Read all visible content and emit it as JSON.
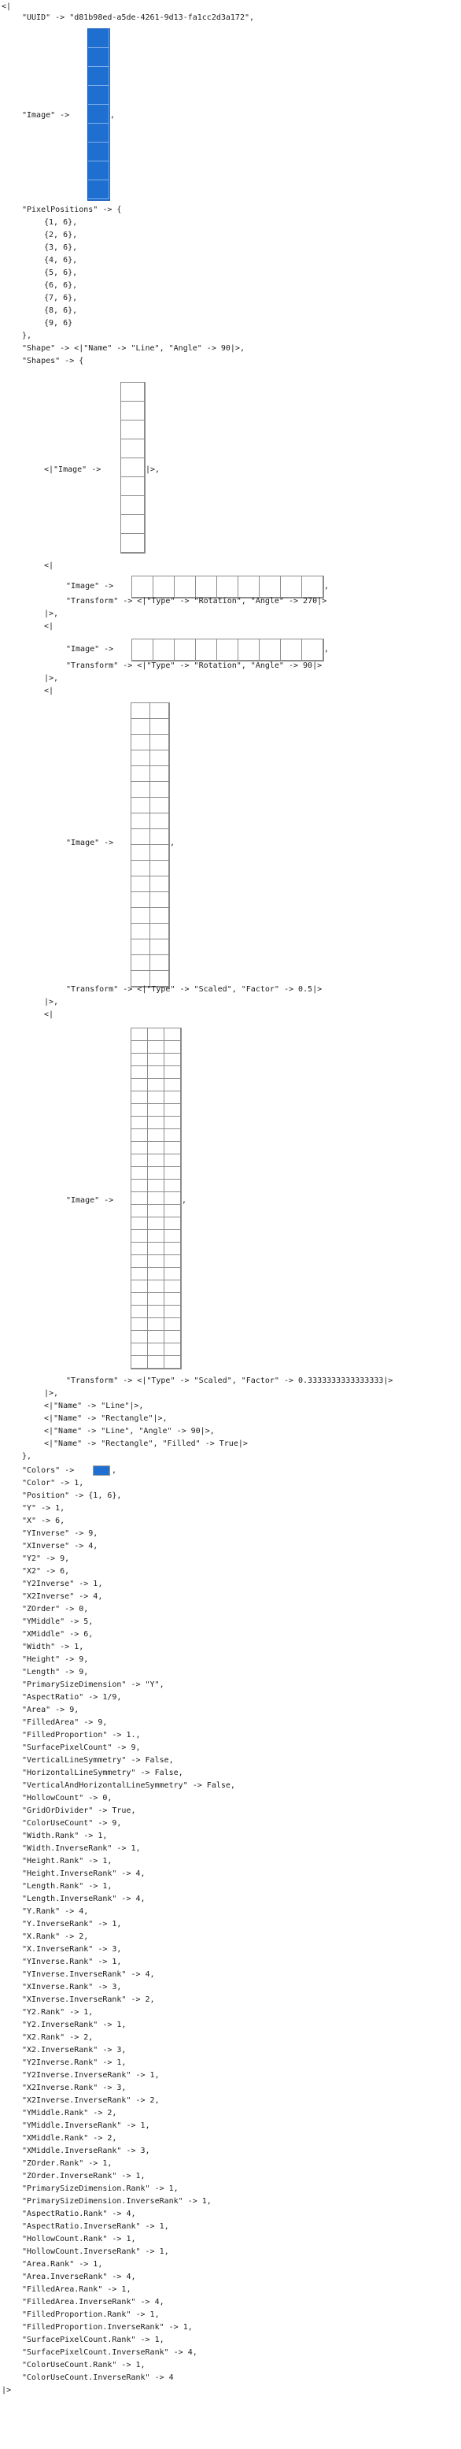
{
  "colors": {
    "blue": "#1f6fd1",
    "cell_border": "#8c8c8c"
  },
  "lines": [
    "<|",
    "\"UUID\" -> \"d81b98ed-a5de-4261-9d13-fa1cc2d3a172\",",
    "\"Image\" ->",
    ",",
    "\"PixelPositions\" -> {",
    "{1, 6},",
    "{2, 6},",
    "{3, 6},",
    "{4, 6},",
    "{5, 6},",
    "{6, 6},",
    "{7, 6},",
    "{8, 6},",
    "{9, 6}",
    "},",
    "\"Shape\" -> <|\"Name\" -> \"Line\", \"Angle\" -> 90|>,",
    "\"Shapes\" -> {",
    "<|\"Image\" ->",
    "|>,",
    "<|",
    "\"Image\" ->",
    ",",
    "\"Transform\" -> <|\"Type\" -> \"Rotation\", \"Angle\" -> 270|>",
    "|>,",
    "<|",
    "\"Image\" ->",
    ",",
    "\"Transform\" -> <|\"Type\" -> \"Rotation\", \"Angle\" -> 90|>",
    "|>,",
    "<|",
    "\"Image\" ->",
    ",",
    "\"Transform\" -> <|\"Type\" -> \"Scaled\", \"Factor\" -> 0.5|>",
    "|>,",
    "<|",
    "\"Image\" ->",
    ",",
    "\"Transform\" -> <|\"Type\" -> \"Scaled\", \"Factor\" -> 0.3333333333333333|>",
    "|>,",
    "<|\"Name\" -> \"Line\"|>,",
    "<|\"Name\" -> \"Rectangle\"|>,",
    "<|\"Name\" -> \"Line\", \"Angle\" -> 90|>,",
    "<|\"Name\" -> \"Rectangle\", \"Filled\" -> True|>",
    "},",
    "\"Colors\" ->",
    ",",
    "\"Color\" -> 1,",
    "\"Position\" -> {1, 6},",
    "\"Y\" -> 1,",
    "\"X\" -> 6,",
    "\"YInverse\" -> 9,",
    "\"XInverse\" -> 4,",
    "\"Y2\" -> 9,",
    "\"X2\" -> 6,",
    "\"Y2Inverse\" -> 1,",
    "\"X2Inverse\" -> 4,",
    "\"ZOrder\" -> 0,",
    "\"YMiddle\" -> 5,",
    "\"XMiddle\" -> 6,",
    "\"Width\" -> 1,",
    "\"Height\" -> 9,",
    "\"Length\" -> 9,",
    "\"PrimarySizeDimension\" -> \"Y\",",
    "\"AspectRatio\" -> 1/9,",
    "\"Area\" -> 9,",
    "\"FilledArea\" -> 9,",
    "\"FilledProportion\" -> 1.,",
    "\"SurfacePixelCount\" -> 9,",
    "\"VerticalLineSymmetry\" -> False,",
    "\"HorizontalLineSymmetry\" -> False,",
    "\"VerticalAndHorizontalLineSymmetry\" -> False,",
    "\"HollowCount\" -> 0,",
    "\"GridOrDivider\" -> True,",
    "\"ColorUseCount\" -> 9,",
    "\"Width.Rank\" -> 1,",
    "\"Width.InverseRank\" -> 1,",
    "\"Height.Rank\" -> 1,",
    "\"Height.InverseRank\" -> 4,",
    "\"Length.Rank\" -> 1,",
    "\"Length.InverseRank\" -> 4,",
    "\"Y.Rank\" -> 4,",
    "\"Y.InverseRank\" -> 1,",
    "\"X.Rank\" -> 2,",
    "\"X.InverseRank\" -> 3,",
    "\"YInverse.Rank\" -> 1,",
    "\"YInverse.InverseRank\" -> 4,",
    "\"XInverse.Rank\" -> 3,",
    "\"XInverse.InverseRank\" -> 2,",
    "\"Y2.Rank\" -> 1,",
    "\"Y2.InverseRank\" -> 1,",
    "\"X2.Rank\" -> 2,",
    "\"X2.InverseRank\" -> 3,",
    "\"Y2Inverse.Rank\" -> 1,",
    "\"Y2Inverse.InverseRank\" -> 1,",
    "\"X2Inverse.Rank\" -> 3,",
    "\"X2Inverse.InverseRank\" -> 2,",
    "\"YMiddle.Rank\" -> 2,",
    "\"YMiddle.InverseRank\" -> 1,",
    "\"XMiddle.Rank\" -> 2,",
    "\"XMiddle.InverseRank\" -> 3,",
    "\"ZOrder.Rank\" -> 1,",
    "\"ZOrder.InverseRank\" -> 1,",
    "\"PrimarySizeDimension.Rank\" -> 1,",
    "\"PrimarySizeDimension.InverseRank\" -> 1,",
    "\"AspectRatio.Rank\" -> 4,",
    "\"AspectRatio.InverseRank\" -> 1,",
    "\"HollowCount.Rank\" -> 1,",
    "\"HollowCount.InverseRank\" -> 1,",
    "\"Area.Rank\" -> 1,",
    "\"Area.InverseRank\" -> 4,",
    "\"FilledArea.Rank\" -> 1,",
    "\"FilledArea.InverseRank\" -> 4,",
    "\"FilledProportion.Rank\" -> 1,",
    "\"FilledProportion.InverseRank\" -> 1,",
    "\"SurfacePixelCount.Rank\" -> 1,",
    "\"SurfacePixelCount.InverseRank\" -> 4,",
    "\"ColorUseCount.Rank\" -> 1,",
    "\"ColorUseCount.InverseRank\" -> 4",
    "|>"
  ]
}
